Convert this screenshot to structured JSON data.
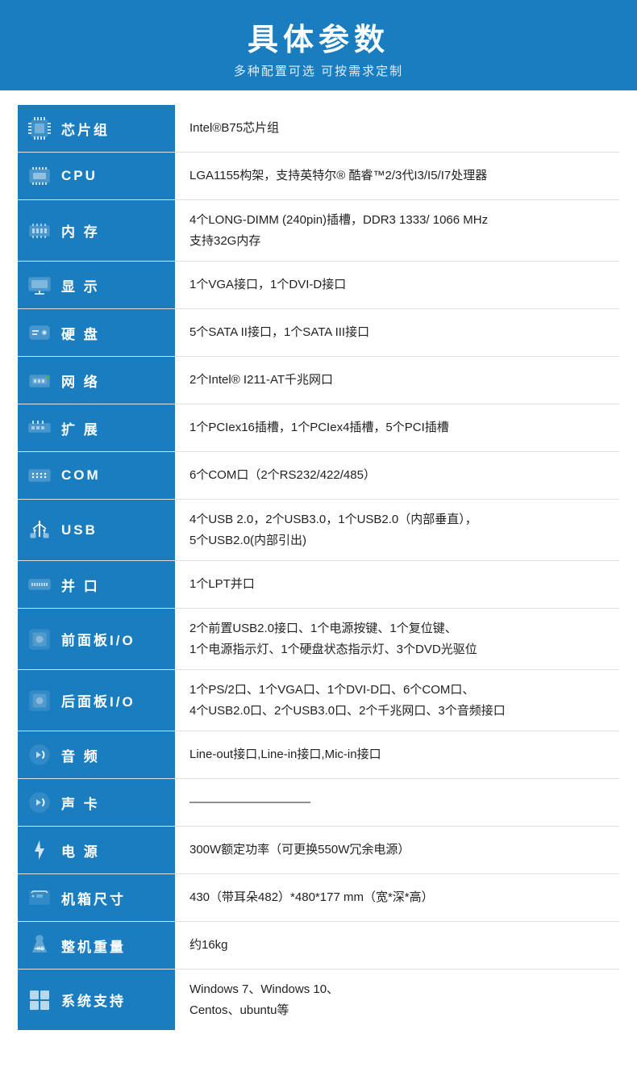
{
  "header": {
    "title": "具体参数",
    "subtitle": "多种配置可选 可按需求定制"
  },
  "rows": [
    {
      "id": "chipset",
      "label": "芯片组",
      "icon": "chipset",
      "value": "Intel®B75芯片组"
    },
    {
      "id": "cpu",
      "label": "CPU",
      "icon": "cpu",
      "value": "LGA1155构架，支持英特尔® 酷睿™2/3代I3/I5/I7处理器"
    },
    {
      "id": "memory",
      "label": "内 存",
      "icon": "memory",
      "value": "4个LONG-DIMM (240pin)插槽，DDR3 1333/ 1066 MHz\n支持32G内存"
    },
    {
      "id": "display",
      "label": "显 示",
      "icon": "display",
      "value": "1个VGA接口，1个DVI-D接口"
    },
    {
      "id": "harddisk",
      "label": "硬 盘",
      "icon": "harddisk",
      "value": "5个SATA II接口，1个SATA III接口"
    },
    {
      "id": "network",
      "label": "网 络",
      "icon": "network",
      "value": "2个Intel® I211-AT千兆网口"
    },
    {
      "id": "expansion",
      "label": "扩 展",
      "icon": "expansion",
      "value": "1个PCIex16插槽，1个PCIex4插槽，5个PCI插槽"
    },
    {
      "id": "com",
      "label": "COM",
      "icon": "com",
      "value": "6个COM口（2个RS232/422/485）"
    },
    {
      "id": "usb",
      "label": "USB",
      "icon": "usb",
      "value": "4个USB 2.0，2个USB3.0，1个USB2.0（内部垂直），\n5个USB2.0(内部引出)"
    },
    {
      "id": "parallel",
      "label": "并 口",
      "icon": "parallel",
      "value": "1个LPT并口"
    },
    {
      "id": "front-io",
      "label": "前面板I/O",
      "icon": "front-io",
      "value": "2个前置USB2.0接口、1个电源按键、1个复位键、\n1个电源指示灯、1个硬盘状态指示灯、3个DVD光驱位"
    },
    {
      "id": "rear-io",
      "label": "后面板I/O",
      "icon": "rear-io",
      "value": "1个PS/2口、1个VGA口、1个DVI-D口、6个COM口、\n4个USB2.0口、2个USB3.0口、2个千兆网口、3个音频接口"
    },
    {
      "id": "audio",
      "label": "音 频",
      "icon": "audio",
      "value": "Line-out接口,Line-in接口,Mic-in接口"
    },
    {
      "id": "soundcard",
      "label": "声 卡",
      "icon": "soundcard",
      "value": "——————————"
    },
    {
      "id": "power",
      "label": "电 源",
      "icon": "power",
      "value": "300W额定功率（可更换550W冗余电源）"
    },
    {
      "id": "chassis",
      "label": "机箱尺寸",
      "icon": "chassis",
      "value": "430（带耳朵482）*480*177 mm（宽*深*高）"
    },
    {
      "id": "weight",
      "label": "整机重量",
      "icon": "weight",
      "value": "约16kg"
    },
    {
      "id": "os",
      "label": "系统支持",
      "icon": "os",
      "value": "Windows 7、Windows 10、\nCentos、ubuntu等"
    }
  ]
}
